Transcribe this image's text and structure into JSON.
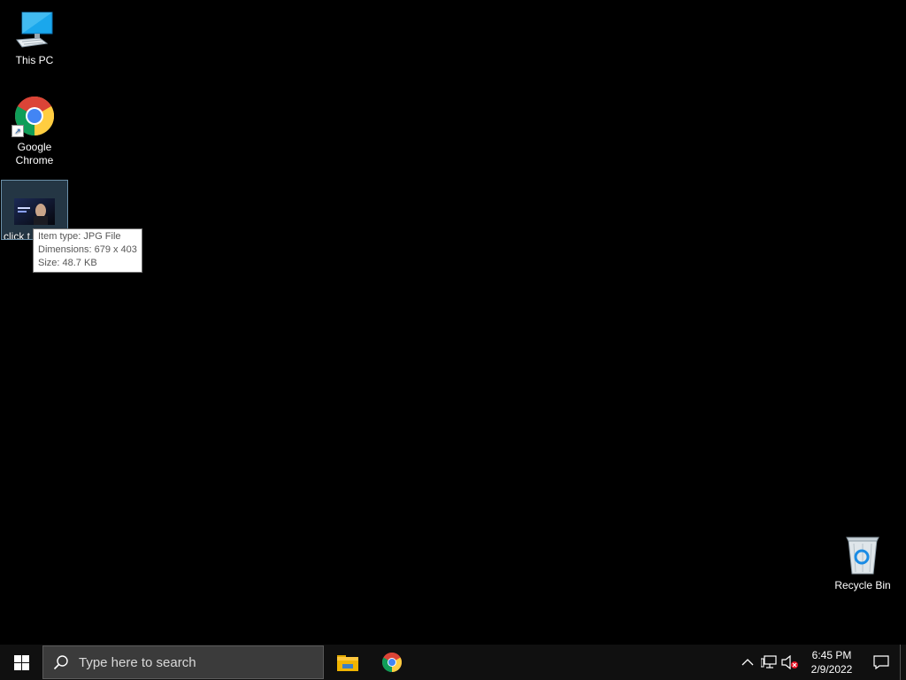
{
  "desktop": {
    "icons": [
      {
        "label": "This PC",
        "icon": "computer-icon"
      },
      {
        "label": "Google Chrome",
        "icon": "chrome-icon",
        "shortcut": true
      },
      {
        "label": "click t",
        "icon": "jpg-thumbnail-icon",
        "selected": true
      },
      {
        "label": "Recycle Bin",
        "icon": "recycle-bin-icon"
      }
    ]
  },
  "tooltip": {
    "lines": [
      "Item type: JPG File",
      "Dimensions: 679 x 403",
      "Size: 48.7 KB"
    ]
  },
  "taskbar": {
    "search_placeholder": "Type here to search",
    "pinned": [
      {
        "name": "File Explorer",
        "icon": "folder-icon"
      },
      {
        "name": "Google Chrome",
        "icon": "chrome-icon"
      }
    ],
    "tray": {
      "time": "6:45 PM",
      "date": "2/9/2022",
      "icons": [
        "chevron-up-icon",
        "network-icon",
        "volume-muted-icon",
        "notification-icon"
      ]
    }
  },
  "colors": {
    "desktop_bg": "#000000",
    "taskbar_bg": "#101010",
    "selection_border": "#6b8fa8",
    "accent_blue": "#1a8ce5"
  }
}
